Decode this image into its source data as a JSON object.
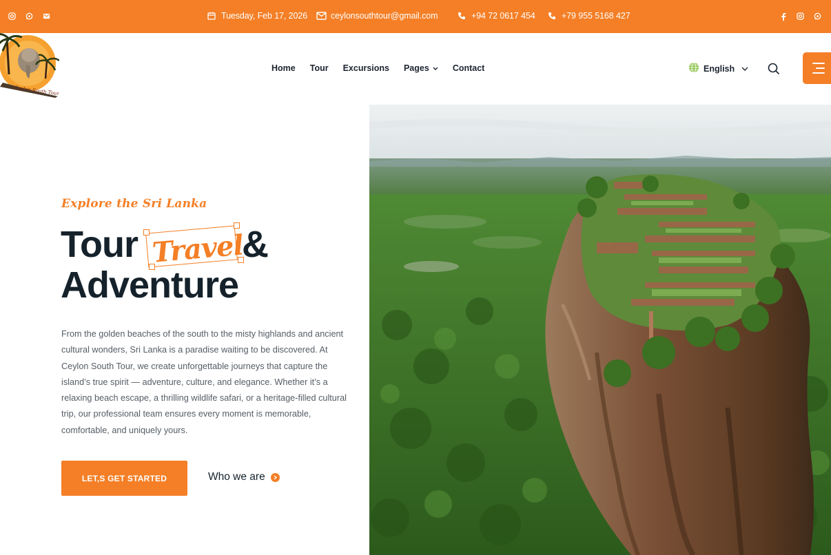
{
  "colors": {
    "accent": "#f47f26",
    "heading": "#15222b",
    "text": "#555d66"
  },
  "topbar": {
    "social_left": [
      "instagram-icon",
      "whatsapp-icon",
      "email-icon"
    ],
    "date": "Tuesday, Feb 17, 2026",
    "email": "ceylonsouthtour@gmail.com",
    "phone1": "+94 72 0617 454",
    "phone2": "+79 955 5168 427",
    "social_right": [
      "facebook-icon",
      "instagram-icon",
      "whatsapp-icon"
    ]
  },
  "header": {
    "logo_text": "Ceylon South Tour",
    "nav": [
      {
        "label": "Home"
      },
      {
        "label": "Tour"
      },
      {
        "label": "Excursions"
      },
      {
        "label": "Pages",
        "dropdown": true
      },
      {
        "label": "Contact"
      }
    ],
    "language": "English"
  },
  "hero": {
    "subtitle": "Explore the Sri Lanka",
    "headline_part1": "Tour",
    "headline_script": "Travel",
    "headline_amp": "&",
    "headline_part2": "Adventure",
    "description": "From the golden beaches of the south to the misty highlands and ancient cultural wonders, Sri Lanka is a paradise waiting to be discovered. At Ceylon South Tour, we create unforgettable journeys that capture the island’s true spirit — adventure, culture, and elegance. Whether it’s a relaxing beach escape, a thrilling wildlife safari, or a heritage-filled cultural trip, our professional team ensures every moment is memorable, comfortable, and uniquely yours.",
    "cta_label": "LET,S GET STARTED",
    "secondary_label": "Who we are"
  }
}
